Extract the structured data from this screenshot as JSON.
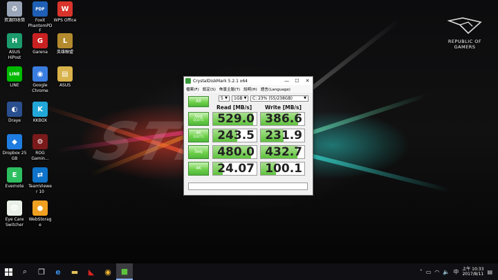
{
  "wallpaper": {
    "text": "STRIX",
    "brand_lines": [
      "REPUBLIC OF",
      "GAMERS"
    ]
  },
  "desktop_icons": [
    {
      "name": "recycle-bin-icon",
      "label": "資源回收筒",
      "color": "#9aa6b8",
      "glyph": "♻"
    },
    {
      "name": "foxit-icon",
      "label": "Foxit PhantomPDF",
      "color": "#1f5fb5",
      "glyph": "PDF"
    },
    {
      "name": "wps-office-icon",
      "label": "WPS Office",
      "color": "#d9342b",
      "glyph": "W"
    },
    {
      "name": "asus-hipost-icon",
      "label": "ASUS HiPost",
      "color": "#1c9b6c",
      "glyph": "H"
    },
    {
      "name": "garena-icon",
      "label": "Garena",
      "color": "#c92121",
      "glyph": "G"
    },
    {
      "name": "lol-icon",
      "label": "英雄聯盟",
      "color": "#b38b2e",
      "glyph": "L"
    },
    {
      "name": "line-icon",
      "label": "LINE",
      "color": "#00b900",
      "glyph": "LINE"
    },
    {
      "name": "chrome-icon",
      "label": "Google Chrome",
      "color": "#3a7de0",
      "glyph": "◉"
    },
    {
      "name": "folder-icon",
      "label": "ASUS",
      "color": "#d8b24a",
      "glyph": "▤"
    },
    {
      "name": "draye-icon",
      "label": "Draye",
      "color": "#2a4f8f",
      "glyph": "◐"
    },
    {
      "name": "kkbox-icon",
      "label": "KKBOX",
      "color": "#22a7d9",
      "glyph": "K"
    },
    {
      "name": "dropbox-icon",
      "label": "Dropbox 25 GB",
      "color": "#1f7ce0",
      "glyph": "◆"
    },
    {
      "name": "rog-gaming-icon",
      "label": "ROG Gamin...",
      "color": "#7a1a1a",
      "glyph": "⚙"
    },
    {
      "name": "evernote-icon",
      "label": "Evernote",
      "color": "#2dbe60",
      "glyph": "E"
    },
    {
      "name": "teamviewer-icon",
      "label": "TeamViewer 10",
      "color": "#0e73c9",
      "glyph": "⇄"
    },
    {
      "name": "eye-care-icon",
      "label": "Eye Care Switcher",
      "color": "#e8f0e8",
      "glyph": "👁"
    },
    {
      "name": "webstorage-icon",
      "label": "WebStorage",
      "color": "#f0a020",
      "glyph": "●"
    }
  ],
  "cdm": {
    "title": "CrystalDiskMark 5.2.1 x64",
    "menu": [
      "檔案(F)",
      "設定(S)",
      "佈景主題(T)",
      "說明(H)",
      "語言(Language)"
    ],
    "runs": "5",
    "size": "1GB",
    "drive": "C: 23% (55/238GB)",
    "all_label": "All",
    "read_header": "Read [MB/s]",
    "write_header": "Write [MB/s]",
    "rows": [
      {
        "label": "Seq",
        "sub": "Q32T1",
        "read": "529.0",
        "write": "386.6",
        "read_frac": 0.92,
        "write_frac": 0.86
      },
      {
        "label": "4K",
        "sub": "Q32T1",
        "read": "243.5",
        "write": "231.9",
        "read_frac": 0.55,
        "write_frac": 0.52
      },
      {
        "label": "Seq",
        "sub": "",
        "read": "480.0",
        "write": "432.7",
        "read_frac": 0.88,
        "write_frac": 0.84
      },
      {
        "label": "4K",
        "sub": "",
        "read": "24.07",
        "write": "100.1",
        "read_frac": 0.22,
        "write_frac": 0.35
      }
    ]
  },
  "taskbar": {
    "clock_time": "上午 10:33",
    "clock_date": "2017/8/11"
  }
}
